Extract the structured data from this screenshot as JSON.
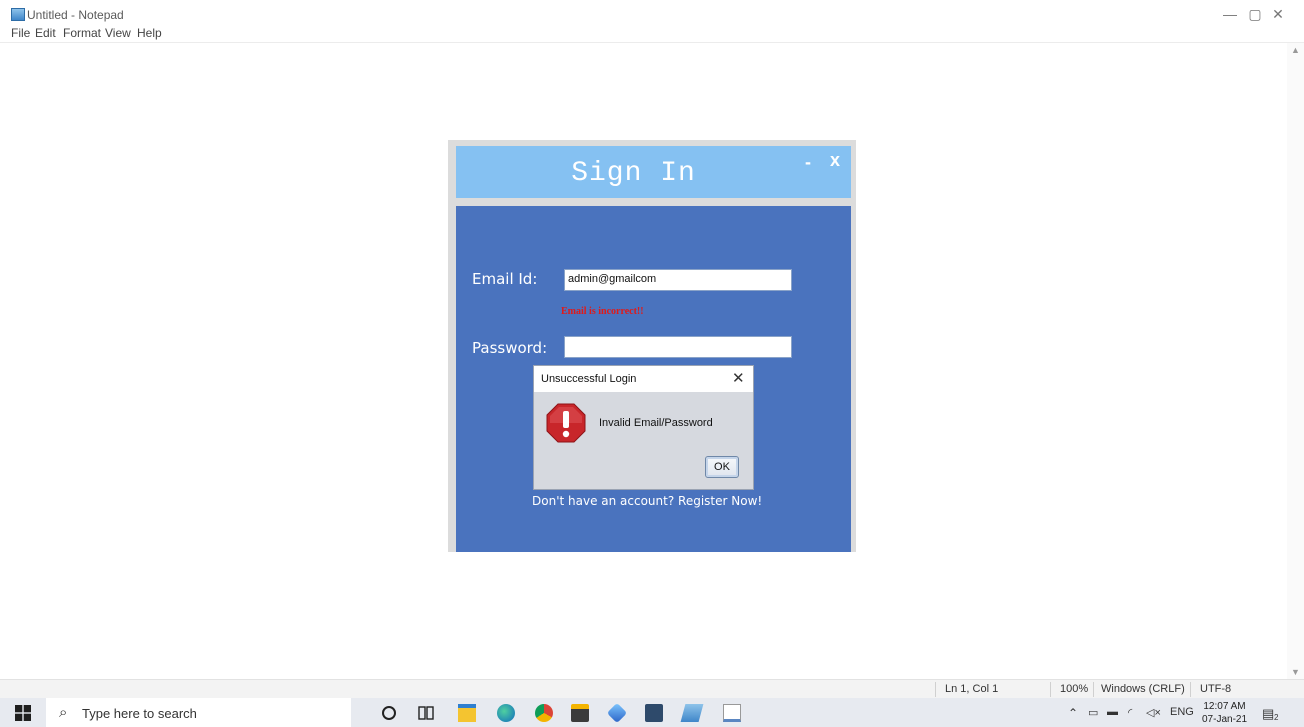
{
  "notepad": {
    "title": "Untitled - Notepad",
    "menu": [
      "File",
      "Edit",
      "Format",
      "View",
      "Help"
    ],
    "window_controls": {
      "minimize": "—",
      "maximize": "▢",
      "close": "✕"
    }
  },
  "signin": {
    "title": "Sign In",
    "minimize_label": "-",
    "close_label": "x",
    "email_label": "Email Id:",
    "email_value": "admin@gmailcom",
    "email_error": "Email is incorrect!!",
    "password_label": "Password:",
    "password_value": "",
    "register_link": "Don't have an account? Register Now!"
  },
  "dialog": {
    "title": "Unsuccessful Login",
    "close_label": "✕",
    "message": "Invalid Email/Password",
    "ok_label": "OK",
    "icon": "error-stop-icon"
  },
  "statusbar": {
    "position": "Ln 1, Col 1",
    "zoom": "100%",
    "line_ending": "Windows (CRLF)",
    "encoding": "UTF-8"
  },
  "taskbar": {
    "search_placeholder": "Type here to search",
    "language": "ENG",
    "time": "12:07 AM",
    "date": "07-Jan-21",
    "notification_count": "2"
  },
  "colors": {
    "signin_header": "#85c1f2",
    "signin_body": "#4a73be",
    "error_text": "#e01a1a"
  }
}
